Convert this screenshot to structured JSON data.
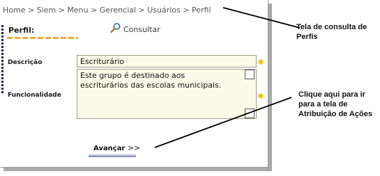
{
  "breadcrumb": {
    "text": "Home > Siem > Menu > Gerencial > Usuários > Perfil"
  },
  "section": {
    "title": "Perfil:"
  },
  "toolbar": {
    "consultar_label": "Consultar",
    "consultar_icon": "magnifier-icon"
  },
  "form": {
    "descricao_label": "Descrição",
    "descricao_value": "Escriturário",
    "funcionalidade_label": "Funcionalidade",
    "funcionalidade_value": "Este grupo é destinado aos\nescriturários das escolas municipais."
  },
  "actions": {
    "avancar_label": "Avançar",
    "avancar_arrows": ">>"
  },
  "annotations": {
    "callout_consulta": "Tela de consulta de Perfis",
    "callout_acoes": "Clique aqui para ir para a tela de Atribuição de Ações"
  },
  "colors": {
    "accent_dash": "#f1a93a",
    "required_dot": "#f3c418",
    "field_background": "#fbfae8"
  }
}
